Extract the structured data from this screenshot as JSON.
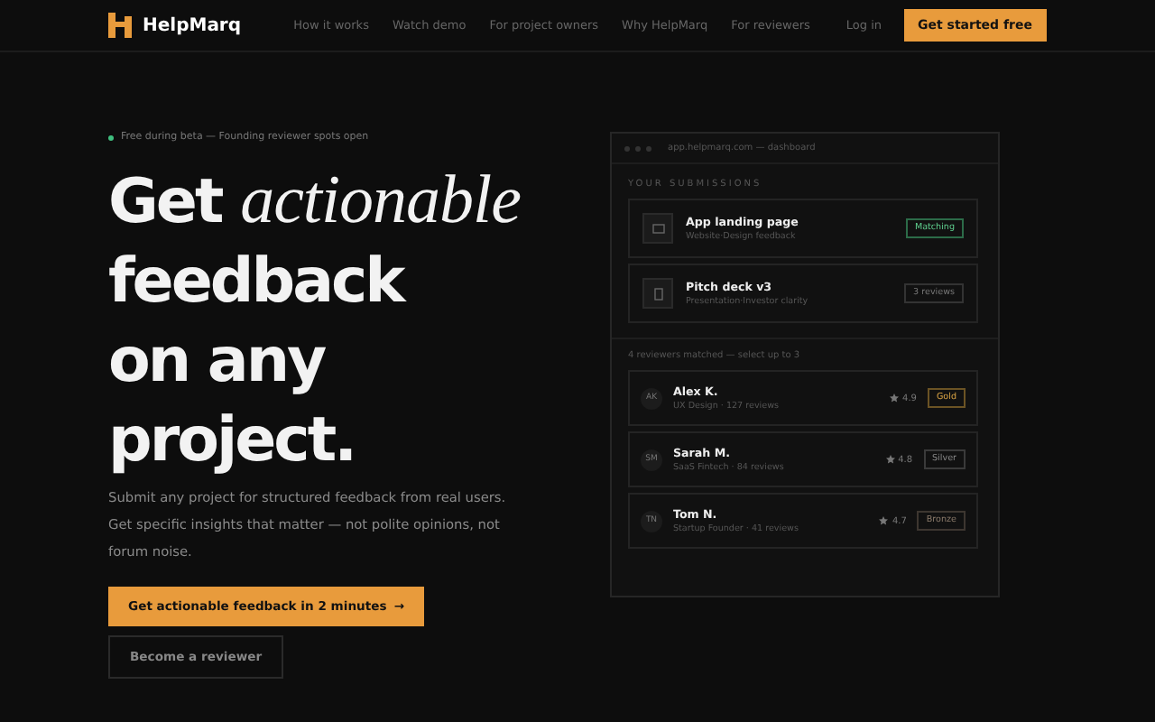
{
  "nav": {
    "brand": "HelpMarq",
    "links": [
      "How it works",
      "Watch demo",
      "For project owners",
      "Why HelpMarq",
      "For reviewers"
    ],
    "login": "Log in",
    "cta": "Get started free"
  },
  "hero": {
    "badge": "Free during beta — Founding reviewer spots open",
    "headline": [
      "Get *actionable*",
      "feedback",
      "on any",
      "project."
    ],
    "lead": "Submit any project for structured feedback from real users. Get specific insights that matter — not polite opinions, not forum noise.",
    "primary": "Get actionable feedback in 2 minutes",
    "primary_arrow": "→",
    "secondary": "Become a reviewer"
  },
  "dashboard": {
    "url": "app.helpmarq.com — dashboard",
    "section": "YOUR SUBMISSIONS",
    "submissions": [
      {
        "kind": "web",
        "title": "App landing page",
        "subtitle": "Website·Design feedback",
        "status": {
          "label": "Matching",
          "kind": "active"
        }
      },
      {
        "kind": "deck",
        "title": "Pitch deck v3",
        "subtitle": "Presentation·Investor clarity",
        "status": {
          "label": "3 reviews",
          "kind": "neutral"
        }
      }
    ],
    "matched": "4 reviewers matched — select up to 3",
    "reviewers": [
      {
        "initials": "AK",
        "name": "Alex K.",
        "meta": "UX Design · 127 reviews",
        "rating": "4.9",
        "tier": {
          "label": "Gold",
          "kind": "gold"
        }
      },
      {
        "initials": "SM",
        "name": "Sarah M.",
        "meta": "SaaS Fintech · 84 reviews",
        "rating": "4.8",
        "tier": {
          "label": "Silver",
          "kind": "silver"
        }
      },
      {
        "initials": "TN",
        "name": "Tom N.",
        "meta": "Startup Founder · 41 reviews",
        "rating": "4.7",
        "tier": {
          "label": "Bronze",
          "kind": "bronze"
        }
      }
    ]
  }
}
